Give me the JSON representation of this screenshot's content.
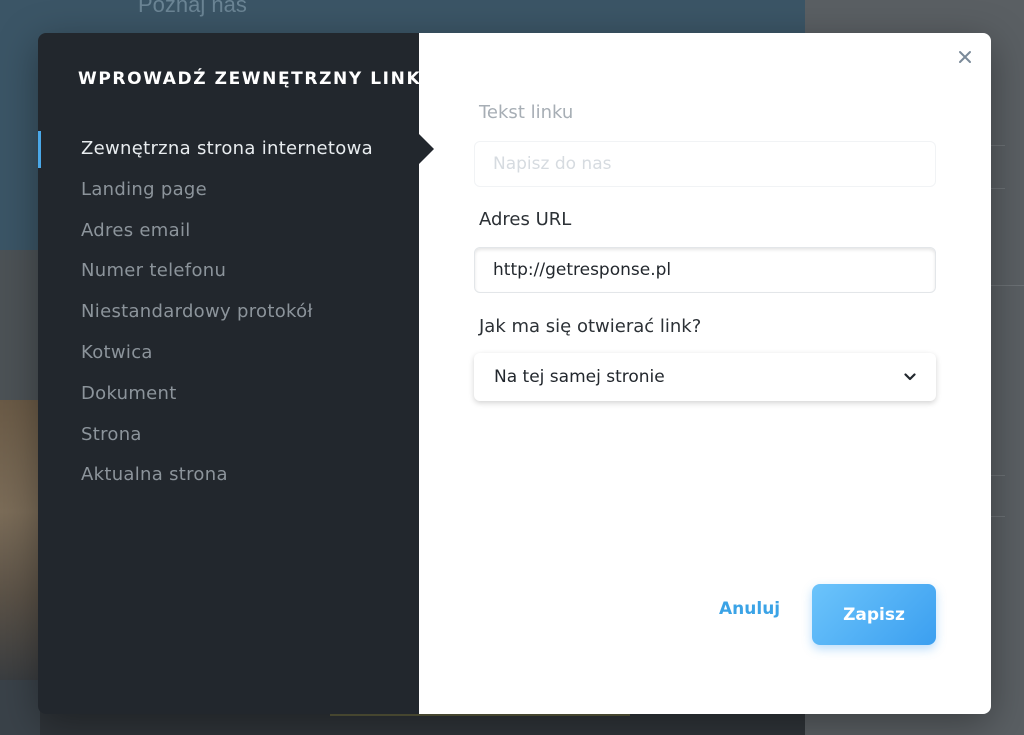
{
  "background": {
    "header_text": "Poznaj nas"
  },
  "modal": {
    "title": "WPROWADŹ ZEWNĘTRZNY LINK",
    "close_icon": "close-icon",
    "sidebar": {
      "items": [
        {
          "label": "Zewnętrzna strona internetowa",
          "active": true
        },
        {
          "label": "Landing page",
          "active": false
        },
        {
          "label": "Adres email",
          "active": false
        },
        {
          "label": "Numer telefonu",
          "active": false
        },
        {
          "label": "Niestandardowy protokół",
          "active": false
        },
        {
          "label": "Kotwica",
          "active": false
        },
        {
          "label": "Dokument",
          "active": false
        },
        {
          "label": "Strona",
          "active": false
        },
        {
          "label": "Aktualna strona",
          "active": false
        }
      ]
    },
    "form": {
      "link_text_label": "Tekst linku",
      "link_text_placeholder": "Napisz do nas",
      "url_label": "Adres URL",
      "url_value": "http://getresponse.pl",
      "open_label": "Jak ma się otwierać link?",
      "open_value": "Na tej samej stronie"
    },
    "buttons": {
      "cancel": "Anuluj",
      "save": "Zapisz"
    }
  },
  "colors": {
    "accent": "#3ba3e6",
    "sidebar_bg": "#22272d",
    "save_gradient_start": "#6cc4fb",
    "save_gradient_end": "#3b9ff0"
  }
}
